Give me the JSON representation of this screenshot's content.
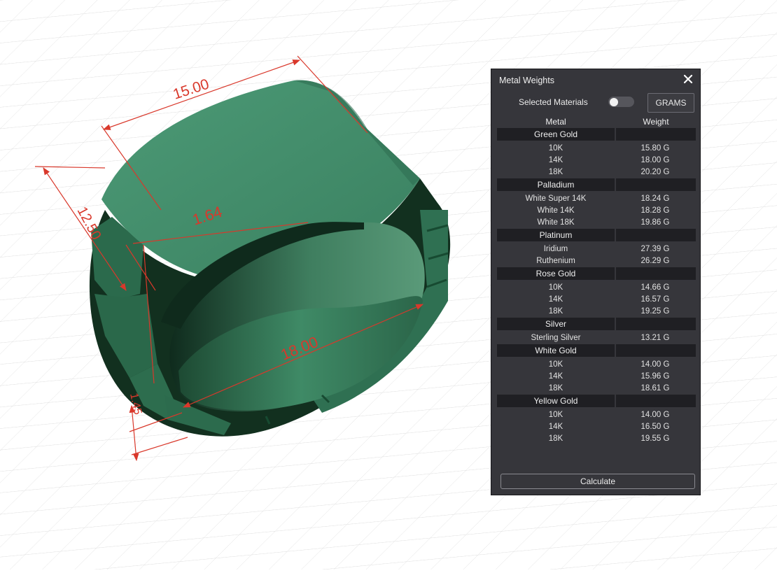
{
  "viewport": {
    "dimensions": [
      "15.00",
      "12.50",
      "1.64",
      "18.00",
      "1.45"
    ],
    "ring_color": "#3f8a68",
    "dimension_color": "#d9382b"
  },
  "panel": {
    "title": "Metal Weights",
    "selected_materials_label": "Selected Materials",
    "selected_materials_on": false,
    "unit_button": "GRAMS",
    "columns": {
      "metal": "Metal",
      "weight": "Weight"
    },
    "groups": [
      {
        "name": "Green Gold",
        "items": [
          {
            "label": "10K",
            "weight": "15.80 G"
          },
          {
            "label": "14K",
            "weight": "18.00 G"
          },
          {
            "label": "18K",
            "weight": "20.20 G"
          }
        ]
      },
      {
        "name": "Palladium",
        "items": [
          {
            "label": "White Super 14K",
            "weight": "18.24 G"
          },
          {
            "label": "White 14K",
            "weight": "18.28 G"
          },
          {
            "label": "White 18K",
            "weight": "19.86 G"
          }
        ]
      },
      {
        "name": "Platinum",
        "items": [
          {
            "label": "Iridium",
            "weight": "27.39 G"
          },
          {
            "label": "Ruthenium",
            "weight": "26.29 G"
          }
        ]
      },
      {
        "name": "Rose Gold",
        "items": [
          {
            "label": "10K",
            "weight": "14.66 G"
          },
          {
            "label": "14K",
            "weight": "16.57 G"
          },
          {
            "label": "18K",
            "weight": "19.25 G"
          }
        ]
      },
      {
        "name": "Silver",
        "items": [
          {
            "label": "Sterling Silver",
            "weight": "13.21 G"
          }
        ]
      },
      {
        "name": "White Gold",
        "items": [
          {
            "label": "10K",
            "weight": "14.00 G"
          },
          {
            "label": "14K",
            "weight": "15.96 G"
          },
          {
            "label": "18K",
            "weight": "18.61 G"
          }
        ]
      },
      {
        "name": "Yellow Gold",
        "items": [
          {
            "label": "10K",
            "weight": "14.00 G"
          },
          {
            "label": "14K",
            "weight": "16.50 G"
          },
          {
            "label": "18K",
            "weight": "19.55 G"
          }
        ]
      }
    ],
    "calculate_label": "Calculate"
  }
}
